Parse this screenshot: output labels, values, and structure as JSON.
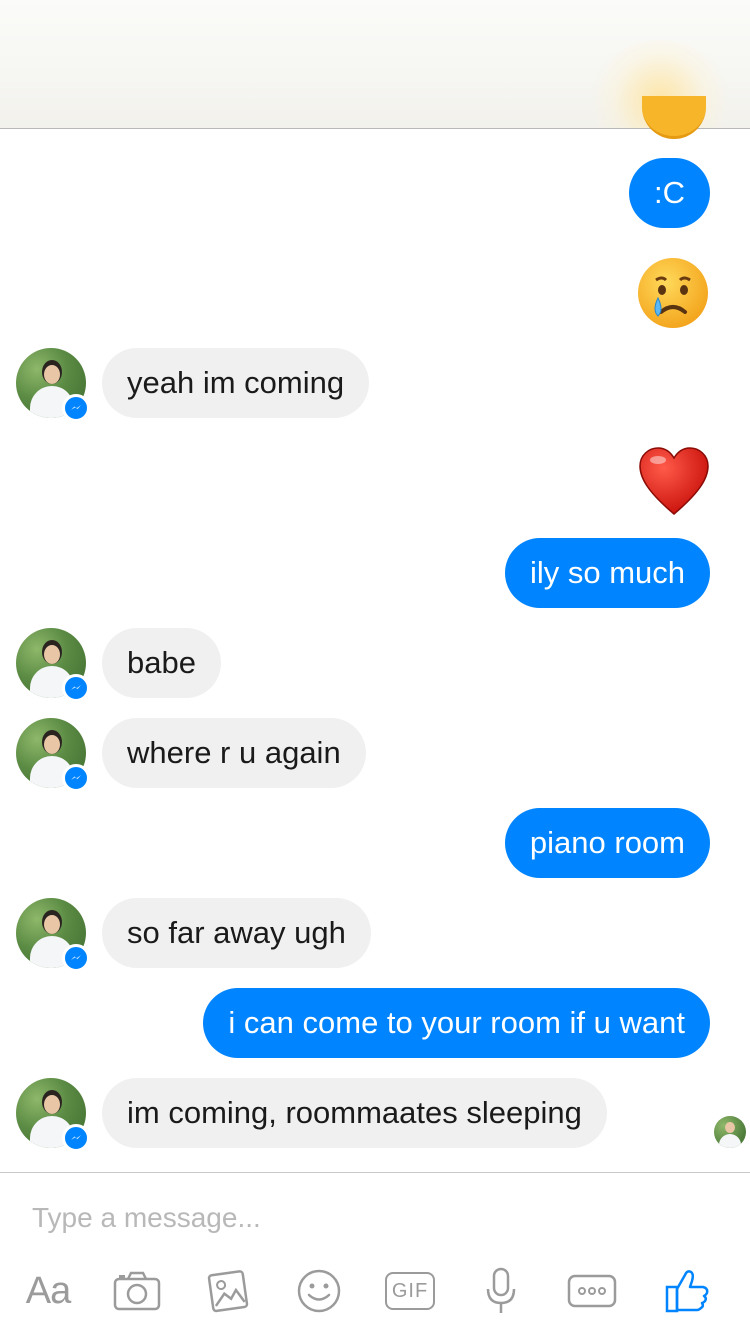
{
  "messages": {
    "m1": "yeah im coming",
    "m2": "ily so much",
    "m3": "babe",
    "m4": "where r u again",
    "m5": "piano room",
    "m6": "so far away ugh",
    "m7": "i can come to your room if u want",
    "m8": "im coming, roommaates sleeping",
    "sent_emoticon": ":C"
  },
  "emoji": {
    "crying": "crying-face-emoji",
    "heart": "red-heart-emoji"
  },
  "composer": {
    "placeholder": "Type a message...",
    "text_label": "Aa",
    "gif_label": "GIF"
  },
  "colors": {
    "outgoing_bubble": "#0084ff",
    "incoming_bubble": "#f0f0f0",
    "like_icon": "#0084ff",
    "toolbar_icons": "#9b9b9b"
  }
}
